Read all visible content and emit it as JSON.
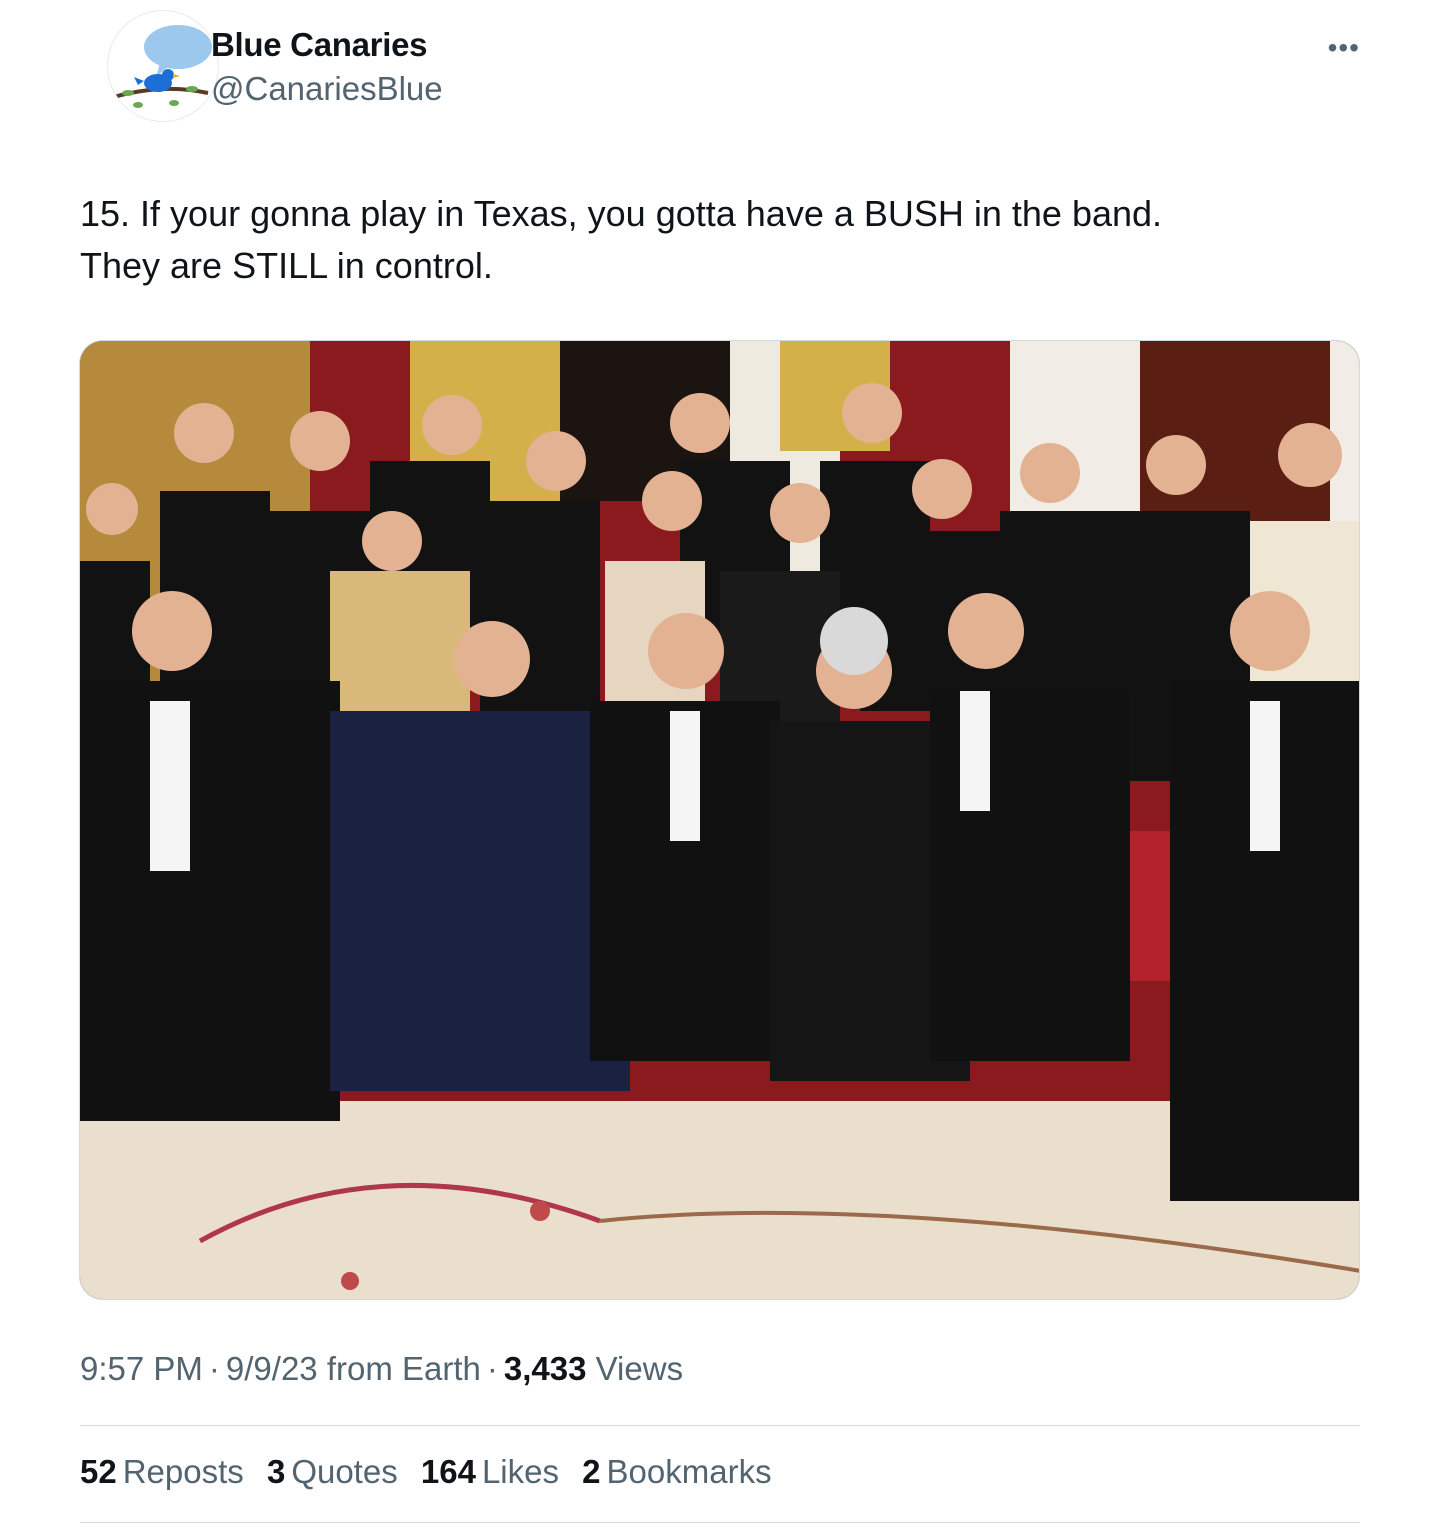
{
  "account": {
    "display_name": "Blue Canaries",
    "handle": "@CanariesBlue",
    "avatar_icon": "blue-bird-on-branch-icon"
  },
  "tweet": {
    "text_line1": "15. If your gonna play in Texas, you gotta have a BUSH in the band.",
    "text_line2": "They are STILL in control."
  },
  "media": {
    "icon": "group-photo-image"
  },
  "meta": {
    "time": "9:57 PM",
    "date": "9/9/23",
    "source_prefix": "from",
    "source": "Earth",
    "views_count": "3,433",
    "views_label": "Views",
    "separator": "·"
  },
  "stats": [
    {
      "count": "52",
      "label": "Reposts"
    },
    {
      "count": "3",
      "label": "Quotes"
    },
    {
      "count": "164",
      "label": "Likes"
    },
    {
      "count": "2",
      "label": "Bookmarks"
    }
  ],
  "more_icon": "more-options-icon",
  "colors": {
    "text_primary": "#0f1419",
    "text_secondary": "#536471",
    "divider": "#cfd9de",
    "avatar_bird": "#1d9bf0"
  }
}
